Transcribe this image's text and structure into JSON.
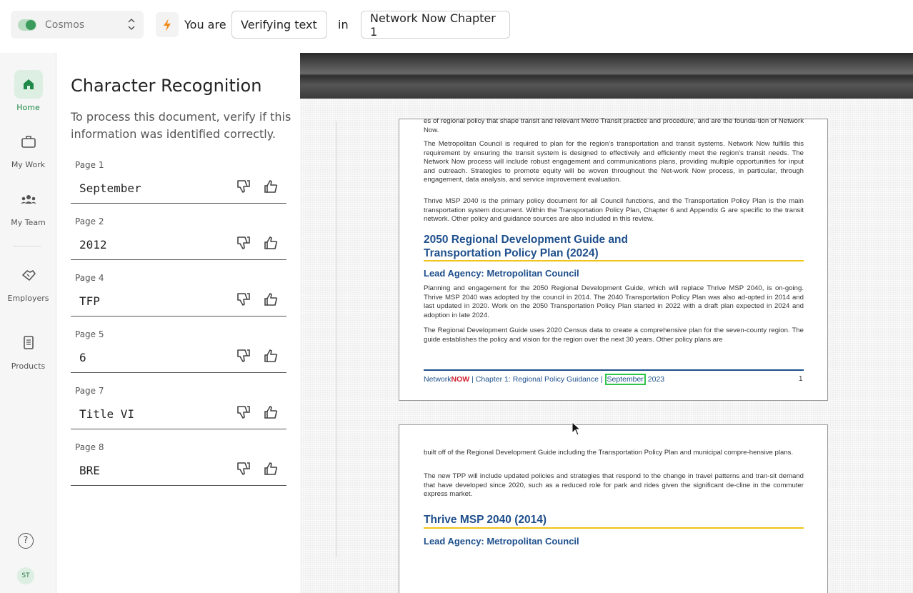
{
  "topbar": {
    "workspace": "Cosmos",
    "you_are_label": "You are",
    "mode": "Verifying text",
    "in_label": "in",
    "document": "Network Now Chapter 1"
  },
  "nav": {
    "items": [
      {
        "label": "Home",
        "icon": "home-icon"
      },
      {
        "label": "My Work",
        "icon": "briefcase-icon"
      },
      {
        "label": "My Team",
        "icon": "team-icon"
      },
      {
        "label": "Employers",
        "icon": "handshake-icon"
      },
      {
        "label": "Products",
        "icon": "document-icon"
      }
    ],
    "help": "?",
    "avatar": "ST",
    "accent_color": "#1f8a47"
  },
  "panel": {
    "title": "Character Recognition",
    "description": "To process this document, verify if this information was identified correctly.",
    "rows": [
      {
        "page": "Page 1",
        "value": "September"
      },
      {
        "page": "Page 2",
        "value": "2012"
      },
      {
        "page": "Page 4",
        "value": "TFP"
      },
      {
        "page": "Page 5",
        "value": "6"
      },
      {
        "page": "Page 7",
        "value": "Title VI"
      },
      {
        "page": "Page 8",
        "value": "BRE"
      }
    ]
  },
  "doc": {
    "page1": {
      "p0": "es of regional policy that shape transit and relevant Metro Transit practice and procedure, and are the founda-tion of Network Now.",
      "p1": "The Metropolitan Council is required to plan for the region’s transportation and transit systems. Network Now fulfills this requirement by ensuring the transit system is designed to effectively and efficiently meet the region’s transit needs. The Network Now process will include robust engagement and communications plans, providing multiple opportunities for input and outreach. Strategies to promote equity will be woven throughout the Net-work Now process, in particular, through engagement, data analysis, and service improvement evaluation.",
      "p2": "Thrive MSP 2040 is the primary policy document for all Council functions, and the Transportation Policy Plan is the main transportation system document. Within the Transportation Policy Plan, Chapter 6 and Appendix G are specific to the transit network. Other policy and guidance sources are also included in this review.",
      "h2_line1": "2050 Regional Development Guide and",
      "h2_line2": "Transportation Policy Plan (2024)",
      "h3": "Lead Agency: Metropolitan Council",
      "p3": "Planning and engagement for the 2050 Regional Development Guide, which will replace Thrive MSP 2040, is on-going. Thrive MSP 2040 was adopted by the council in 2014. The 2040 Transportation Policy Plan was also ad-opted in 2014 and last updated in 2020. Work on the 2050 Transportation Policy Plan started in 2022 with a draft plan expected in 2024 and adoption in late 2024.",
      "p4": "The Regional Development Guide uses 2020 Census data to create a comprehensive plan for the seven-county region. The guide establishes the policy and vision for the region over the next 30 years. Other policy plans are",
      "footer_network": "Network",
      "footer_now": "NOW",
      "footer_chapter": " | Chapter 1: Regional Policy Guidance | ",
      "footer_month": "September",
      "footer_year": " 2023",
      "page_number": "1"
    },
    "page2": {
      "p1": "built off of the Regional Development Guide including the Transportation Policy Plan and municipal compre-hensive plans.",
      "p2": "The new TPP will include updated policies and strategies that respond to the change in travel patterns and tran-sit demand that have developed since 2020, such as a reduced role for park and rides given the significant de-cline in the commuter express market.",
      "h2": "Thrive MSP 2040 (2014)",
      "h3": "Lead Agency: Metropolitan Council"
    },
    "highlight_color": "#2fc44a",
    "heading_color": "#1e4f8c",
    "rule_color": "#f0c419"
  }
}
